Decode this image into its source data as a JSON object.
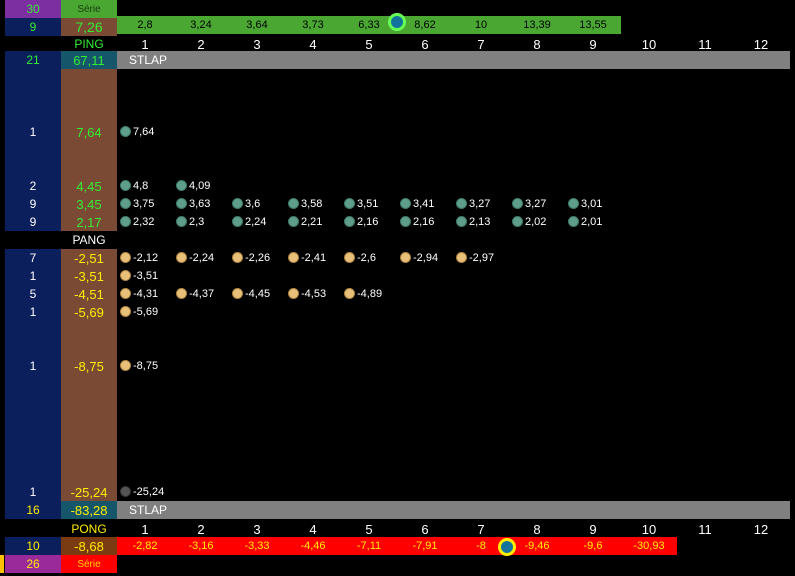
{
  "colors": {
    "navy": "#0b1f5c",
    "brown": "#7a4a35",
    "teal": "#15566b",
    "purple": "#7b2fa0",
    "green_bar": "#4aa832",
    "red_bar": "#ff0000",
    "stlap": "#808080",
    "pos_text": "#33ee33",
    "neg_text": "#ffee00",
    "pos_dot": "#5e9e8a",
    "neg_dot": "#e8c07a",
    "last_dot": "#555555"
  },
  "top": {
    "serie_count": "30",
    "serie_label": "Série",
    "series_count": "9",
    "series_avg": "7,26",
    "series_values": [
      "2,8",
      "3,24",
      "3,64",
      "3,73",
      "6,33",
      "8,62",
      "10",
      "13,39",
      "13,55"
    ],
    "marker_after_col": 5
  },
  "ping_label": "PING",
  "pong_label": "PONG",
  "pang_label": "PANG",
  "columns": [
    "1",
    "2",
    "3",
    "4",
    "5",
    "6",
    "7",
    "8",
    "9",
    "10",
    "11",
    "12"
  ],
  "stlap_top": {
    "count": "21",
    "avg": "67,11",
    "label": "STLAP"
  },
  "ping_rows": [
    {
      "count": "1",
      "avg": "7,64",
      "values": [
        "7,64"
      ]
    },
    {
      "count": "2",
      "avg": "4,45",
      "values": [
        "4,8",
        "4,09"
      ]
    },
    {
      "count": "9",
      "avg": "3,45",
      "values": [
        "3,75",
        "3,63",
        "3,6",
        "3,58",
        "3,51",
        "3,41",
        "3,27",
        "3,27",
        "3,01"
      ]
    },
    {
      "count": "9",
      "avg": "2,17",
      "values": [
        "2,32",
        "2,3",
        "2,24",
        "2,21",
        "2,16",
        "2,16",
        "2,13",
        "2,02",
        "2,01"
      ]
    }
  ],
  "pang_rows": [
    {
      "count": "7",
      "avg": "-2,51",
      "values": [
        "-2,12",
        "-2,24",
        "-2,26",
        "-2,41",
        "-2,6",
        "-2,94",
        "-2,97"
      ]
    },
    {
      "count": "1",
      "avg": "-3,51",
      "values": [
        "-3,51"
      ]
    },
    {
      "count": "5",
      "avg": "-4,51",
      "values": [
        "-4,31",
        "-4,37",
        "-4,45",
        "-4,53",
        "-4,89"
      ]
    },
    {
      "count": "1",
      "avg": "-5,69",
      "values": [
        "-5,69"
      ]
    },
    {
      "count": "1",
      "avg": "-8,75",
      "values": [
        "-8,75"
      ]
    },
    {
      "count": "1",
      "avg": "-25,24",
      "values": [
        "-25,24"
      ]
    }
  ],
  "stlap_bottom": {
    "count": "16",
    "avg": "-83,28",
    "label": "STLAP"
  },
  "bottom": {
    "series_count": "10",
    "series_avg": "-8,68",
    "series_values": [
      "-2,82",
      "-3,16",
      "-3,33",
      "-4,46",
      "-7,11",
      "-7,91",
      "-8",
      "-9,46",
      "-9,6",
      "-30,93"
    ],
    "marker_after_col": 7,
    "serie_count": "26",
    "serie_label": "Série"
  }
}
